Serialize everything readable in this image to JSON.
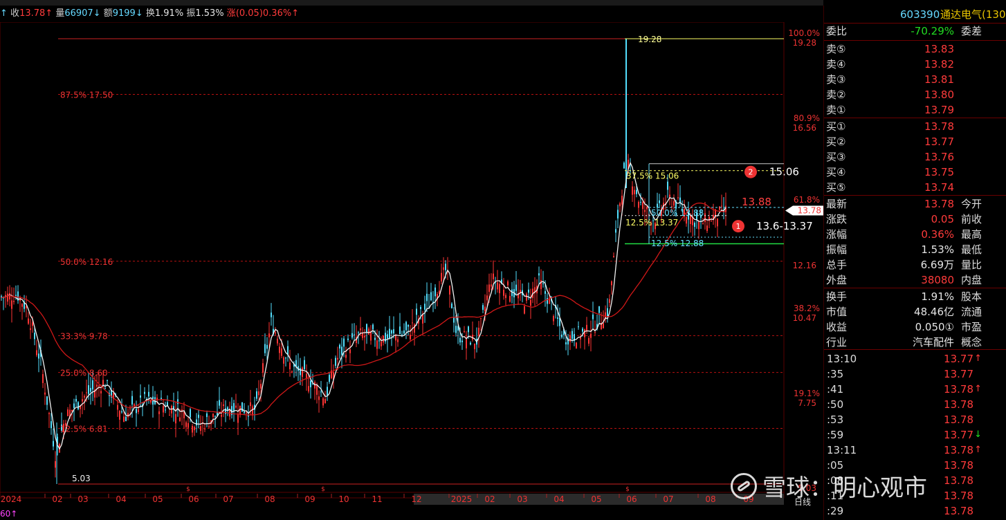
{
  "info_bar": {
    "close_label": "收",
    "close_value": "13.78↑",
    "vol_label": "量",
    "vol_value": "66907↓",
    "amount_label": "额",
    "amount_value": "9199↓",
    "turnover_label": "换",
    "turnover_value": "1.91%",
    "amplitude_label": "振",
    "amplitude_value": "1.53%",
    "change_label": "涨",
    "change_value": "(0.05)0.36%↑"
  },
  "right_axis": [
    {
      "pct": "100.0%",
      "price": "19.28"
    },
    {
      "pct": "80.9%",
      "price": "16.56"
    },
    {
      "pct": "61.8%",
      "price": ""
    },
    {
      "pct": "",
      "price": "12.16"
    },
    {
      "pct": "38.2%",
      "price": "10.47"
    },
    {
      "pct": "19.1%",
      "price": "7.75"
    },
    {
      "pct": "",
      "price": "5.03"
    }
  ],
  "left_levels": [
    {
      "text": "87.5% 17.50"
    },
    {
      "text": "50.0% 12.16"
    },
    {
      "text": "33.3% 9.78"
    },
    {
      "text": "25.0% 8.60"
    },
    {
      "text": "12.5% 6.81"
    }
  ],
  "annotations": {
    "high": "19.28",
    "low": "5.03",
    "fib_375": "37.5% 15.06",
    "fib_500": "50.0% 13.88",
    "fib_125a": "12.5% 13.37",
    "fib_125b": "12.5% 12.88",
    "target1_value": "15.06",
    "target2_value": "13.88",
    "range_value": "13.6-13.37",
    "badge1": "1",
    "badge2": "2",
    "price_tag": "13.78"
  },
  "time_axis": [
    "2024",
    "02",
    "03",
    "04",
    "05",
    "06",
    "07",
    "08",
    "09",
    "10",
    "11",
    "12",
    "2025",
    "02",
    "03",
    "04",
    "05",
    "06",
    "07",
    "08",
    "09"
  ],
  "bottom_left": "60↑",
  "bottom_right": "日线",
  "panel": {
    "code": "603390",
    "name": "通达电气(130",
    "weibi_label": "委比",
    "weibi_value": "-70.29%",
    "weicha_label": "委差",
    "sells": [
      {
        "label": "卖⑤",
        "price": "13.83"
      },
      {
        "label": "卖④",
        "price": "13.82"
      },
      {
        "label": "卖③",
        "price": "13.81"
      },
      {
        "label": "卖②",
        "price": "13.80"
      },
      {
        "label": "卖①",
        "price": "13.79"
      }
    ],
    "buys": [
      {
        "label": "买①",
        "price": "13.78"
      },
      {
        "label": "买②",
        "price": "13.77"
      },
      {
        "label": "买③",
        "price": "13.76"
      },
      {
        "label": "买④",
        "price": "13.75"
      },
      {
        "label": "买⑤",
        "price": "13.74"
      }
    ],
    "stats": [
      {
        "label": "最新",
        "value": "13.78",
        "color": "red",
        "label2": "今开"
      },
      {
        "label": "涨跌",
        "value": "0.05",
        "color": "red",
        "label2": "前收"
      },
      {
        "label": "涨幅",
        "value": "0.36%",
        "color": "red",
        "label2": "最高"
      },
      {
        "label": "振幅",
        "value": "1.53%",
        "color": "wht",
        "label2": "最低"
      },
      {
        "label": "总手",
        "value": "6.69万",
        "color": "wht",
        "label2": "量比"
      },
      {
        "label": "外盘",
        "value": "38080",
        "color": "red",
        "label2": "内盘"
      }
    ],
    "stats2": [
      {
        "label": "换手",
        "value": "1.91%",
        "color": "wht",
        "label2": "股本"
      },
      {
        "label": "市值",
        "value": "48.46亿",
        "color": "wht",
        "label2": "流通"
      },
      {
        "label": "收益",
        "value": "0.050①",
        "color": "wht",
        "label2": "市盈"
      },
      {
        "label": "行业",
        "value": "汽车配件",
        "color": "wht",
        "label2": "概念"
      }
    ],
    "ticks": [
      {
        "time": "13:10",
        "price": "13.77",
        "arrow": "↑",
        "dir": "up"
      },
      {
        "time": ":35",
        "price": "13.77",
        "arrow": "",
        "dir": ""
      },
      {
        "time": ":41",
        "price": "13.78",
        "arrow": "↑",
        "dir": "up"
      },
      {
        "time": ":50",
        "price": "13.78",
        "arrow": "",
        "dir": ""
      },
      {
        "time": ":53",
        "price": "13.78",
        "arrow": "",
        "dir": ""
      },
      {
        "time": ":59",
        "price": "13.77",
        "arrow": "↓",
        "dir": "down"
      },
      {
        "time": "13:11",
        "price": "13.78",
        "arrow": "↑",
        "dir": "up"
      },
      {
        "time": ":05",
        "price": "13.78",
        "arrow": "",
        "dir": ""
      },
      {
        "time": ":08",
        "price": "13.78",
        "arrow": "",
        "dir": ""
      },
      {
        "time": ":11",
        "price": "13.78",
        "arrow": "",
        "dir": ""
      },
      {
        "time": ":29",
        "price": "13.78",
        "arrow": "",
        "dir": ""
      }
    ]
  },
  "watermark": "雪球：明心观市"
}
